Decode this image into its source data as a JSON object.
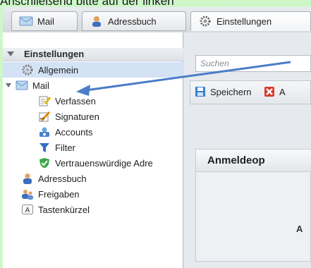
{
  "caption": "Anschließend bitte auf der linken",
  "tabs": [
    {
      "label": "Mail",
      "icon": "envelope-icon"
    },
    {
      "label": "Adressbuch",
      "icon": "contact-person-icon"
    },
    {
      "label": "Einstellungen",
      "icon": "gear-icon"
    }
  ],
  "sidebar": {
    "header": "Einstellungen",
    "items": [
      {
        "label": "Allgemein",
        "icon": "gear-icon"
      },
      {
        "label": "Mail",
        "icon": "envelope-icon"
      },
      {
        "label": "Verfassen",
        "icon": "compose-icon"
      },
      {
        "label": "Signaturen",
        "icon": "signature-pen-icon"
      },
      {
        "label": "Accounts",
        "icon": "accounts-icon"
      },
      {
        "label": "Filter",
        "icon": "filter-icon"
      },
      {
        "label": "Vertrauenswürdige Adre",
        "icon": "shield-check-icon"
      },
      {
        "label": "Adressbuch",
        "icon": "contact-person-icon"
      },
      {
        "label": "Freigaben",
        "icon": "share-people-icon"
      },
      {
        "label": "Tastenkürzel",
        "icon": "keyboard-key-icon"
      }
    ]
  },
  "right": {
    "search_placeholder": "Suchen",
    "toolbar": {
      "save": "Speichern",
      "second": "A"
    },
    "box": {
      "title": "Anmeldeop",
      "letter": "A"
    }
  }
}
